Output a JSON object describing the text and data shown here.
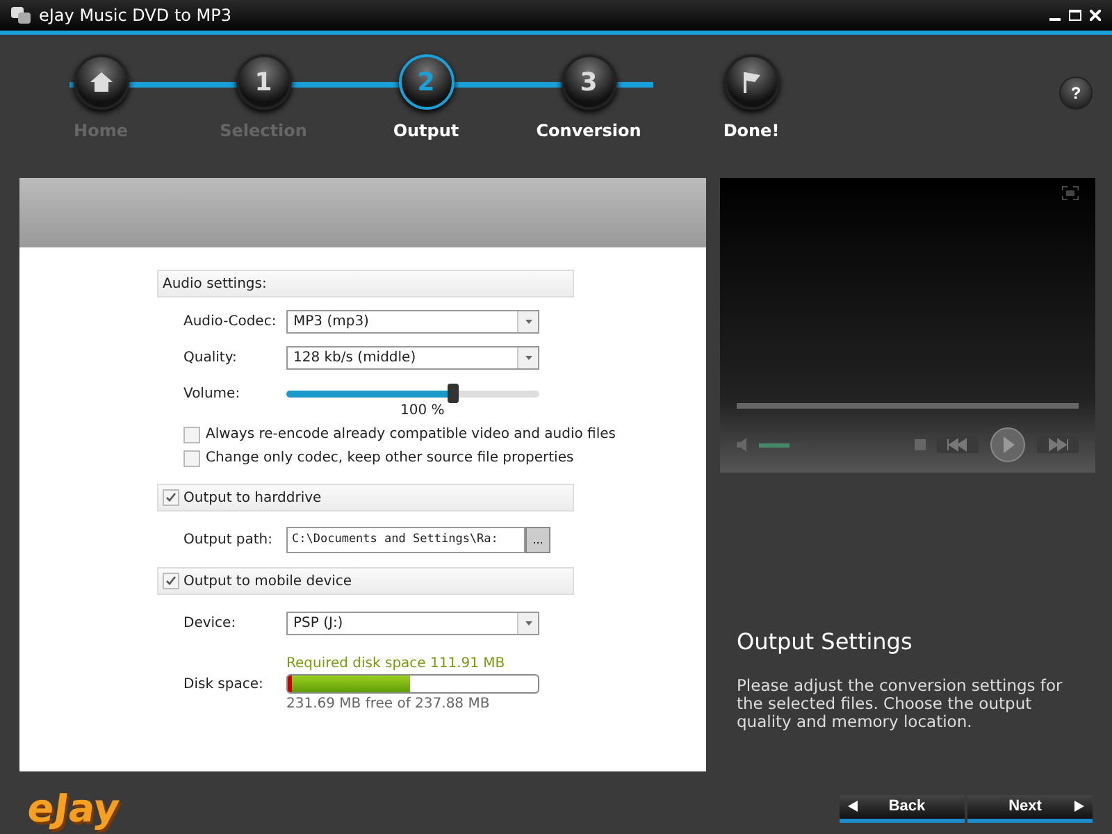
{
  "window": {
    "title": "eJay Music DVD to MP3"
  },
  "steps": [
    {
      "kind": "icon",
      "label": "Home",
      "selected": false,
      "disabled": true
    },
    {
      "kind": "number",
      "number": "1",
      "label": "Selection",
      "selected": false,
      "disabled": true
    },
    {
      "kind": "number",
      "number": "2",
      "label": "Output",
      "selected": true,
      "disabled": false
    },
    {
      "kind": "number",
      "number": "3",
      "label": "Conversion",
      "selected": false,
      "disabled": false
    },
    {
      "kind": "flag",
      "label": "Done!",
      "selected": false,
      "disabled": false
    }
  ],
  "help_button": "?",
  "audio_settings": {
    "title": "Audio settings:",
    "codec": {
      "label": "Audio-Codec:",
      "value": "MP3 (mp3)"
    },
    "quality": {
      "label": "Quality:",
      "value": "128 kb/s (middle)"
    },
    "volume": {
      "label": "Volume:",
      "level": 0.66,
      "reading": "100 %"
    },
    "options": [
      {
        "label": "Always re-encode already compatible video and audio files",
        "checked": false
      },
      {
        "label": "Change only codec, keep other source file properties",
        "checked": false
      }
    ]
  },
  "harddrive": {
    "title": "Output to harddrive",
    "checked": true,
    "path_label": "Output path:",
    "path": "C:\\Documents and Settings\\Ra:",
    "browse": "..."
  },
  "mobile": {
    "title": "Output to mobile device",
    "checked": true,
    "device_label": "Device:",
    "device": "PSP (J:)",
    "required": "Required disk space 111.91 MB",
    "disk_label": "Disk space:",
    "level": 0.49,
    "free": "231.69 MB free of 237.88 MB"
  },
  "player": {
    "progress": {
      "level": 0
    },
    "volume": {
      "level": 0.6
    }
  },
  "info": {
    "title": "Output Settings",
    "text": "Please adjust the conversion settings for the selected files. Choose the output quality and memory location."
  },
  "logo": "eJay",
  "buttons": [
    {
      "kind": "back",
      "label": "Back"
    },
    {
      "kind": "next",
      "label": "Next"
    }
  ]
}
